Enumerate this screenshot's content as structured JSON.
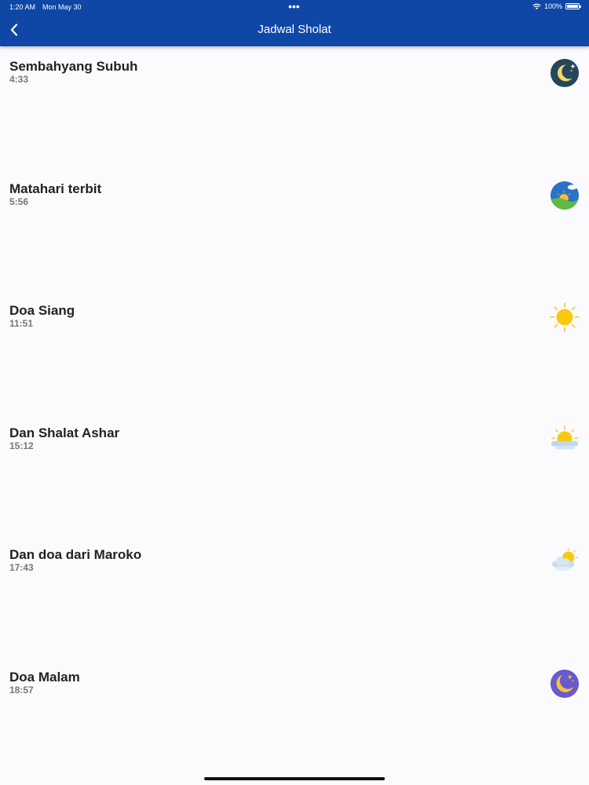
{
  "status_bar": {
    "time": "1:20 AM",
    "date": "Mon May 30",
    "dots": "•••",
    "battery": "100%"
  },
  "header": {
    "title": "Jadwal Sholat"
  },
  "prayers": [
    {
      "name": "Sembahyang Subuh",
      "time": "4:33",
      "icon": "moon-night-icon"
    },
    {
      "name": "Matahari terbit",
      "time": "5:56",
      "icon": "sunrise-icon"
    },
    {
      "name": "Doa Siang",
      "time": "11:51",
      "icon": "sun-icon"
    },
    {
      "name": "Dan Shalat Ashar",
      "time": "15:12",
      "icon": "sun-cloud-icon"
    },
    {
      "name": "Dan doa dari Maroko",
      "time": "17:43",
      "icon": "cloudy-sun-icon"
    },
    {
      "name": "Doa Malam",
      "time": "18:57",
      "icon": "moon-stars-icon"
    }
  ],
  "colors": {
    "header_bg": "#0f47a7",
    "background": "#fbfbfd"
  }
}
